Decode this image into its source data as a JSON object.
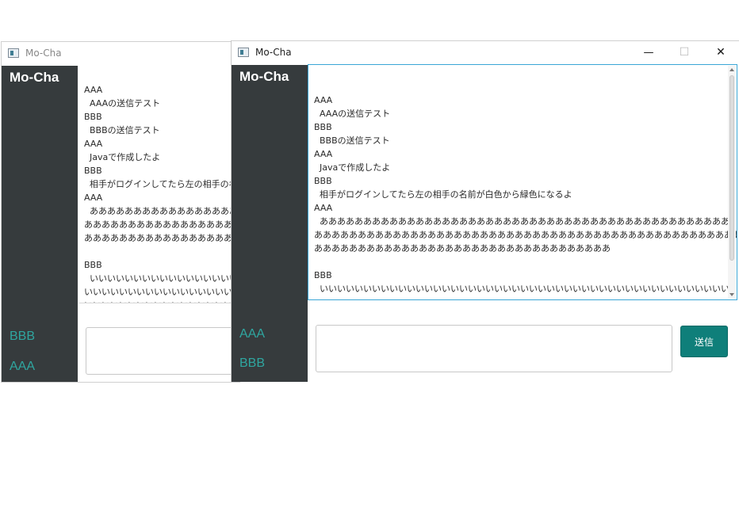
{
  "back_window": {
    "title": "Mo-Cha",
    "brand": "Mo-Cha",
    "users": [
      "BBB",
      "AAA"
    ],
    "log_lines": [
      "AAA",
      "  AAAの送信テスト",
      "BBB",
      "  BBBの送信テスト",
      "AAA",
      "  Javaで作成したよ",
      "BBB",
      "  相手がログインしてたら左の相手の名前が白色から緑色になるよ",
      "AAA",
      "  ああああああああああああああああああああああああああああああああああああああああああああああああ",
      "ああああああああああああああああああああああああああああああああああああああああああああああああ",
      "ああああああああああああああああああああああああああああああああああ",
      "",
      "BBB",
      "  いいいいいいいいいいいいいいいいいいいいいいいいいいいいいいいいいいいいいいいいいいいいいいいい",
      "いいいいいいいいいいいいいいいいいいいいいいいいいいいいいいいいいいいいいいいいいいいいいいいいい",
      "いいいいいいいいいいいいいいいいいいいいいいい"
    ]
  },
  "front_window": {
    "title": "Mo-Cha",
    "brand": "Mo-Cha",
    "users": [
      "AAA",
      "BBB"
    ],
    "log_lines": [
      "AAA",
      "  AAAの送信テスト",
      "BBB",
      "  BBBの送信テスト",
      "AAA",
      "  Javaで作成したよ",
      "BBB",
      "  相手がログインしてたら左の相手の名前が白色から緑色になるよ",
      "AAA",
      "  あああああああああああああああああああああああああああああああああああああああああああああああ",
      "あああああああああああああああああああああああああああああああああああああああああああああああああ",
      "ああああああああああああああああああああああああああああああああああ",
      "",
      "BBB",
      "  いいいいいいいいいいいいいいいいいいいいいいいいいいいいいいいいいいいいいいいいいいいいいいい"
    ],
    "send_label": "送信",
    "controls": {
      "minimize": "—",
      "maximize": "☐",
      "close": "✕"
    }
  },
  "colors": {
    "sidebar_bg": "#363b3d",
    "user_online": "#2fa6a0",
    "send_button": "#0f7f7a",
    "focus_border": "#3aa6d6"
  }
}
